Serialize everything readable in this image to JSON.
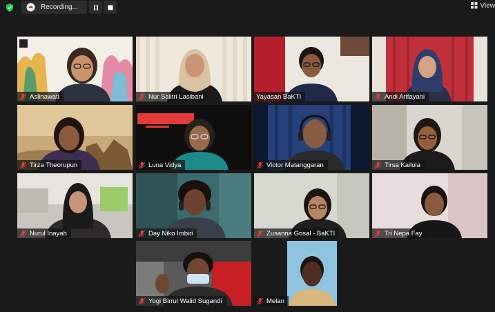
{
  "toolbar": {
    "recording_label": "Recording...",
    "view_label": "View"
  },
  "participants": [
    {
      "name": "Aslinawati",
      "muted": true,
      "active_speaker": true
    },
    {
      "name": "Nur Salitri Lasibani",
      "muted": true
    },
    {
      "name": "Yayasan BaKTI",
      "muted": false
    },
    {
      "name": "Andi Arifayani",
      "muted": true
    },
    {
      "name": "Tirza Theorupun",
      "muted": true
    },
    {
      "name": "Luna Vidya",
      "muted": true
    },
    {
      "name": "Victor Matanggaran",
      "muted": true
    },
    {
      "name": "Tirsa Kailola",
      "muted": true
    },
    {
      "name": "Nurul Inayah",
      "muted": true
    },
    {
      "name": "Day Niko Imbiri",
      "muted": true
    },
    {
      "name": "Zusanna Gosal - BaKTI",
      "muted": true
    },
    {
      "name": "Tri Nepa Fay",
      "muted": true
    },
    {
      "name": "Yogi Birrul Walid Sugandi",
      "muted": true
    },
    {
      "name": "Melan",
      "muted": true
    }
  ],
  "colors": {
    "muted_icon": "#e0403a",
    "active_speaker_border": "#d6e06a",
    "shield": "#23c552"
  }
}
